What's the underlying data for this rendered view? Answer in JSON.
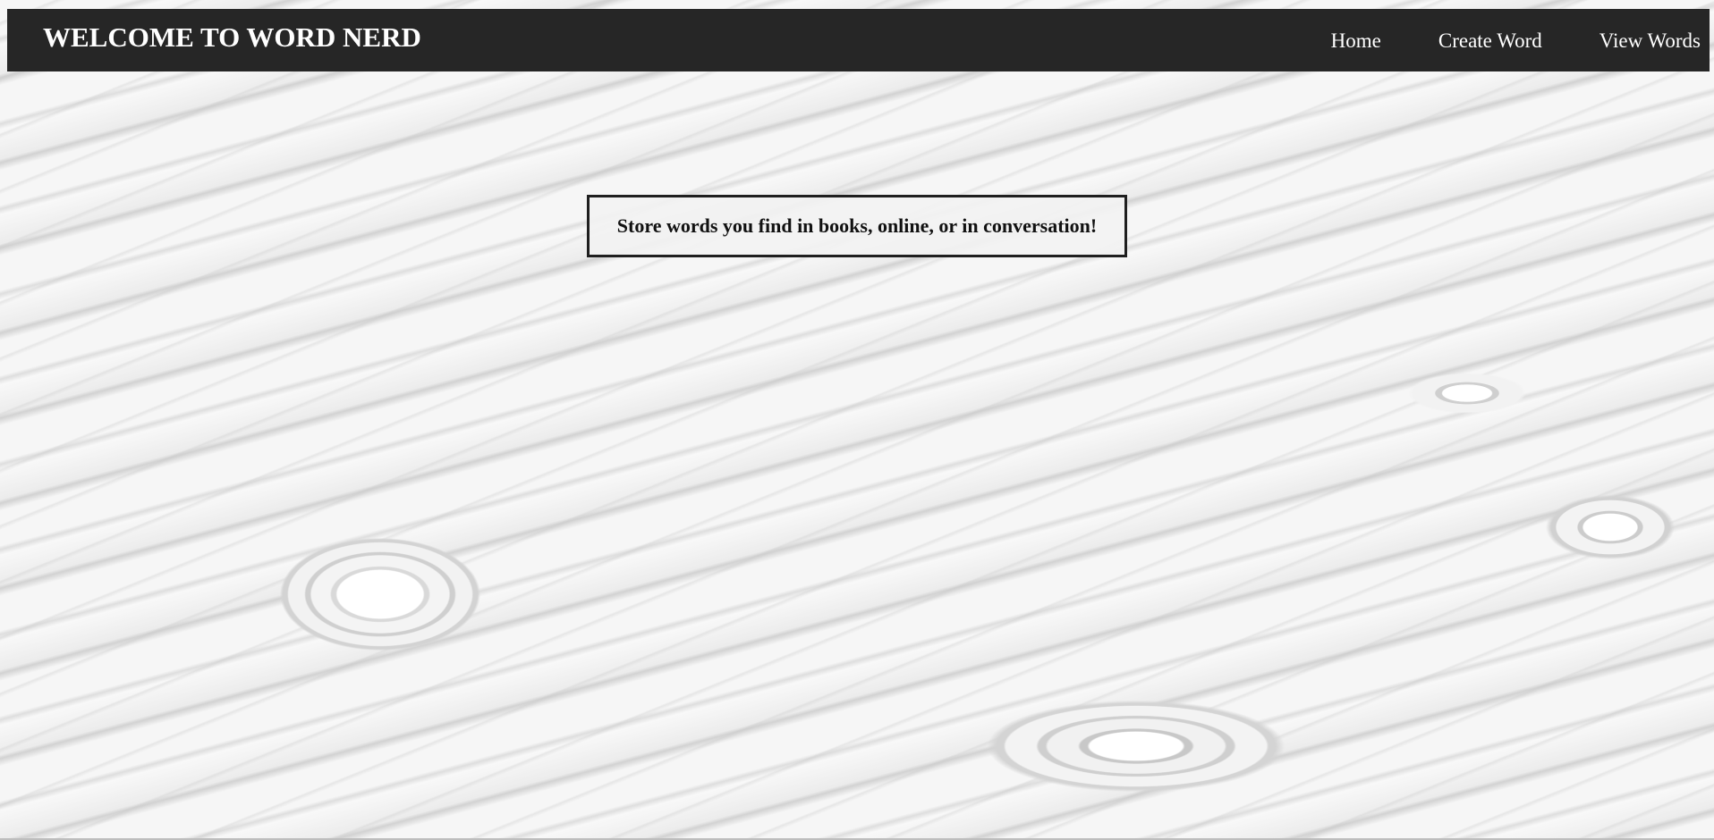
{
  "header": {
    "title": "WELCOME TO WORD NERD",
    "nav": [
      {
        "label": "Home"
      },
      {
        "label": "Create Word"
      },
      {
        "label": "View Words"
      }
    ]
  },
  "main": {
    "tagline": "Store words you find in books, online, or in conversation!",
    "background": "swirling-paper-background-image"
  },
  "colors": {
    "navbar": "#262626",
    "nav_text": "#ffffff",
    "tagline_border": "#1f1f1f"
  }
}
